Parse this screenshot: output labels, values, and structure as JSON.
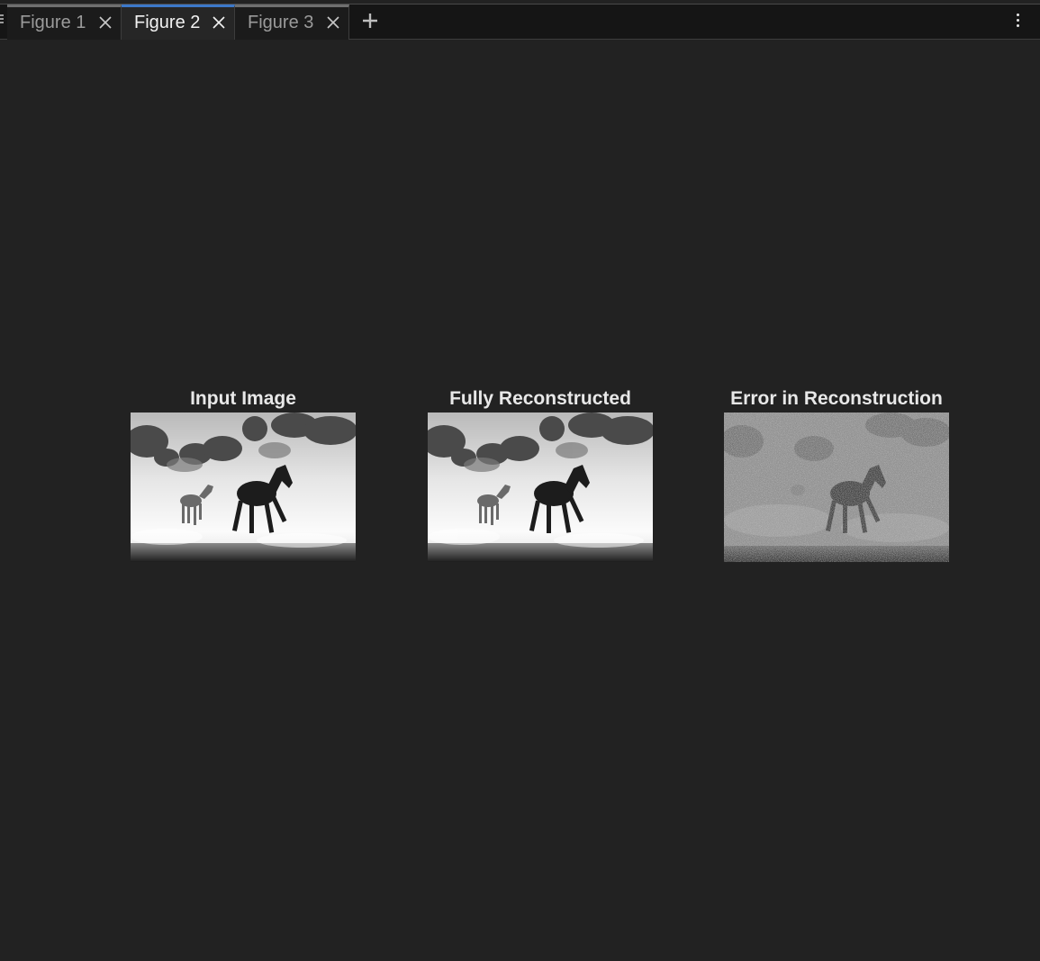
{
  "tabs": [
    {
      "label": "Figure 1",
      "active": false
    },
    {
      "label": "Figure 2",
      "active": true
    },
    {
      "label": "Figure 3",
      "active": false
    }
  ],
  "toolbar": {
    "add_tab_icon": "plus-icon",
    "menu_icon": "vertical-ellipsis-icon",
    "grip_icon": "grip-icon"
  },
  "figure": {
    "subplots": [
      {
        "title": "Input Image",
        "image": "grayscale horses in dust"
      },
      {
        "title": "Fully Reconstructed",
        "image": "grayscale horses in dust"
      },
      {
        "title": "Error in Reconstruction",
        "image": "noisy error map of horses"
      }
    ]
  },
  "colors": {
    "background": "#222222",
    "tabbar": "#151515",
    "active_tab_accent": "#3c78c9",
    "inactive_tab_accent": "#6f6f6f",
    "title_text": "#e8e8e8"
  }
}
